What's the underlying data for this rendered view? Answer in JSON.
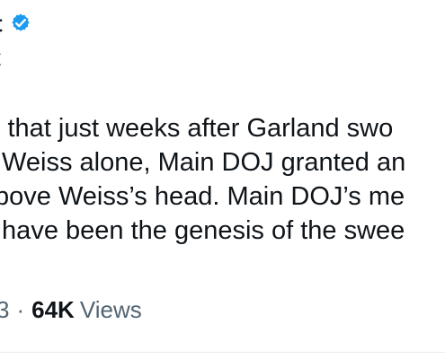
{
  "tweet": {
    "display_name": "t",
    "handle": "t",
    "body_lines": [
      "l that just weeks after Garland swo",
      " Weiss alone, Main DOJ granted an",
      "bove Weiss’s head. Main DOJ’s me",
      " have been the genesis of the swee"
    ],
    "timestamp_fragment": "3",
    "separator": "·",
    "views_count": "64K",
    "views_label": "Views"
  },
  "icons": {
    "verified": "verified-badge-icon"
  },
  "colors": {
    "text": "#0f1419",
    "secondary_text": "#536471",
    "verified_blue": "#1d9bf0",
    "divider": "#e7ecf0"
  }
}
